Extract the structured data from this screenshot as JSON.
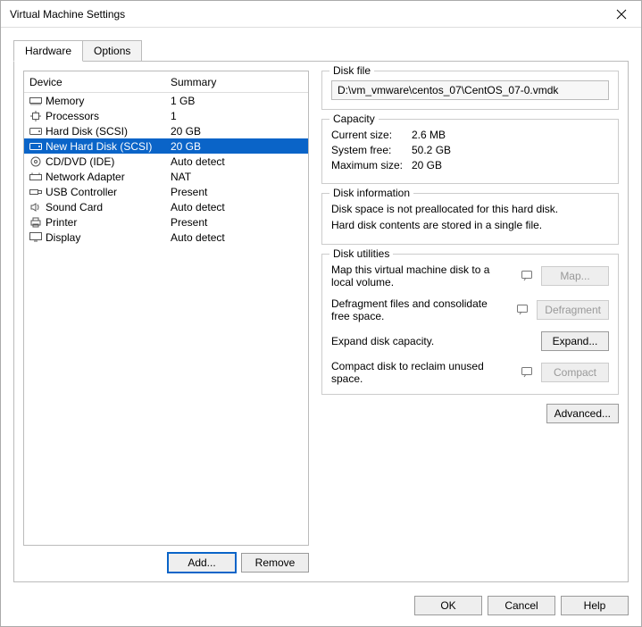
{
  "title": "Virtual Machine Settings",
  "tabs": {
    "hardware": "Hardware",
    "options": "Options"
  },
  "listHeaders": {
    "device": "Device",
    "summary": "Summary"
  },
  "devices": [
    {
      "icon": "memory",
      "name": "Memory",
      "summary": "1 GB"
    },
    {
      "icon": "cpu",
      "name": "Processors",
      "summary": "1"
    },
    {
      "icon": "disk",
      "name": "Hard Disk (SCSI)",
      "summary": "20 GB"
    },
    {
      "icon": "disk",
      "name": "New Hard Disk (SCSI)",
      "summary": "20 GB"
    },
    {
      "icon": "cd",
      "name": "CD/DVD (IDE)",
      "summary": "Auto detect"
    },
    {
      "icon": "net",
      "name": "Network Adapter",
      "summary": "NAT"
    },
    {
      "icon": "usb",
      "name": "USB Controller",
      "summary": "Present"
    },
    {
      "icon": "sound",
      "name": "Sound Card",
      "summary": "Auto detect"
    },
    {
      "icon": "printer",
      "name": "Printer",
      "summary": "Present"
    },
    {
      "icon": "display",
      "name": "Display",
      "summary": "Auto detect"
    }
  ],
  "selectedIndex": 3,
  "leftButtons": {
    "add": "Add...",
    "remove": "Remove"
  },
  "diskFile": {
    "title": "Disk file",
    "value": "D:\\vm_vmware\\centos_07\\CentOS_07-0.vmdk"
  },
  "capacity": {
    "title": "Capacity",
    "currentLabel": "Current size:",
    "currentValue": "2.6 MB",
    "freeLabel": "System free:",
    "freeValue": "50.2 GB",
    "maxLabel": "Maximum size:",
    "maxValue": "20 GB"
  },
  "diskInfo": {
    "title": "Disk information",
    "line1": "Disk space is not preallocated for this hard disk.",
    "line2": "Hard disk contents are stored in a single file."
  },
  "utilities": {
    "title": "Disk utilities",
    "mapText": "Map this virtual machine disk to a local volume.",
    "mapBtn": "Map...",
    "defragText": "Defragment files and consolidate free space.",
    "defragBtn": "Defragment",
    "expandText": "Expand disk capacity.",
    "expandBtn": "Expand...",
    "compactText": "Compact disk to reclaim unused space.",
    "compactBtn": "Compact"
  },
  "advanced": "Advanced...",
  "footer": {
    "ok": "OK",
    "cancel": "Cancel",
    "help": "Help"
  }
}
